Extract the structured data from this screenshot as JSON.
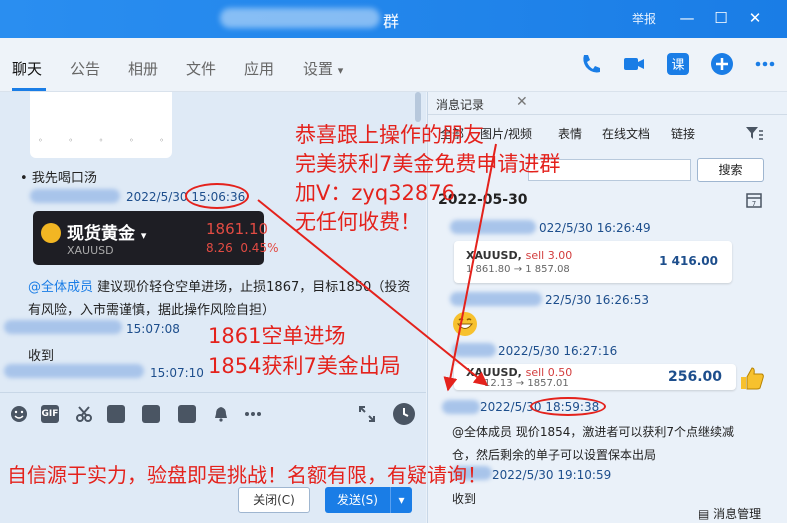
{
  "window": {
    "title": "群",
    "report": "举报",
    "minimize": "—",
    "maximize": "☐",
    "close": "✕"
  },
  "tabs": [
    "聊天",
    "公告",
    "相册",
    "文件",
    "应用",
    "设置"
  ],
  "chat": {
    "messages": [
      {
        "text": "我先喝口汤"
      },
      {
        "time": "2022/5/30 15:06:36"
      },
      {
        "mention": "@全体成员",
        "text": " 建议现价轻仓空单进场，止损1867，目标1850（投资"
      },
      {
        "text": "有风险，入市需谨慎，据此操作风险自担）"
      },
      {
        "time": "15:07:08"
      },
      {
        "text": "收到"
      },
      {
        "time": "15:07:10"
      }
    ],
    "gold_card": {
      "name": "现货黄金",
      "symbol": "XAUUSD",
      "price": "1861.10",
      "change": "8.26",
      "change_pct": "0.45%"
    },
    "buttons": {
      "close": "关闭(C)",
      "send": "发送(S)"
    }
  },
  "side": {
    "tab_label": "消息记录",
    "categories": [
      "全部",
      "图片/视频",
      "表情",
      "在线文档",
      "链接"
    ],
    "search_button": "搜索",
    "date_header": "2022-05-30",
    "entries": [
      {
        "time": "022/5/30 16:26:49"
      },
      {
        "symbol": "XAUUSD",
        "side": "sell 3.00",
        "range": "1 861.80 → 1 857.08",
        "profit": "1 416.00"
      },
      {
        "time": "22/5/30 16:26:53"
      },
      {
        "time": "2022/5/30 16:27:16"
      },
      {
        "symbol": "XAUUSD",
        "side": "sell 0.50",
        "range": "12.13 → 1857.01",
        "profit": "256.00"
      },
      {
        "time": "2022/5/30 18:59:38"
      },
      {
        "mention": "@全体成员",
        "text": " 现价1854，激进者可以获利7个点继续减"
      },
      {
        "text": "仓，然后剩余的单子可以设置保本出局"
      },
      {
        "time": "2022/5/30 19:10:59"
      },
      {
        "text": "收到"
      }
    ],
    "manage": "消息管理"
  },
  "overlay": {
    "lines_top": [
      "恭喜跟上操作的朋友",
      "完美获利7美金免费申请进群",
      "加V：zyq32876",
      "无任何收费！"
    ],
    "lines_mid": [
      "1861空单进场",
      "1854获利7美金出局"
    ],
    "line_bottom": "自信源于实力，验盘即是挑战！名额有限，有疑请询！"
  },
  "colors": {
    "accent": "#1a7de6",
    "overlay_red": "#e4221c",
    "sell_red": "#d23c3c",
    "profit_blue": "#1d4e8c"
  }
}
